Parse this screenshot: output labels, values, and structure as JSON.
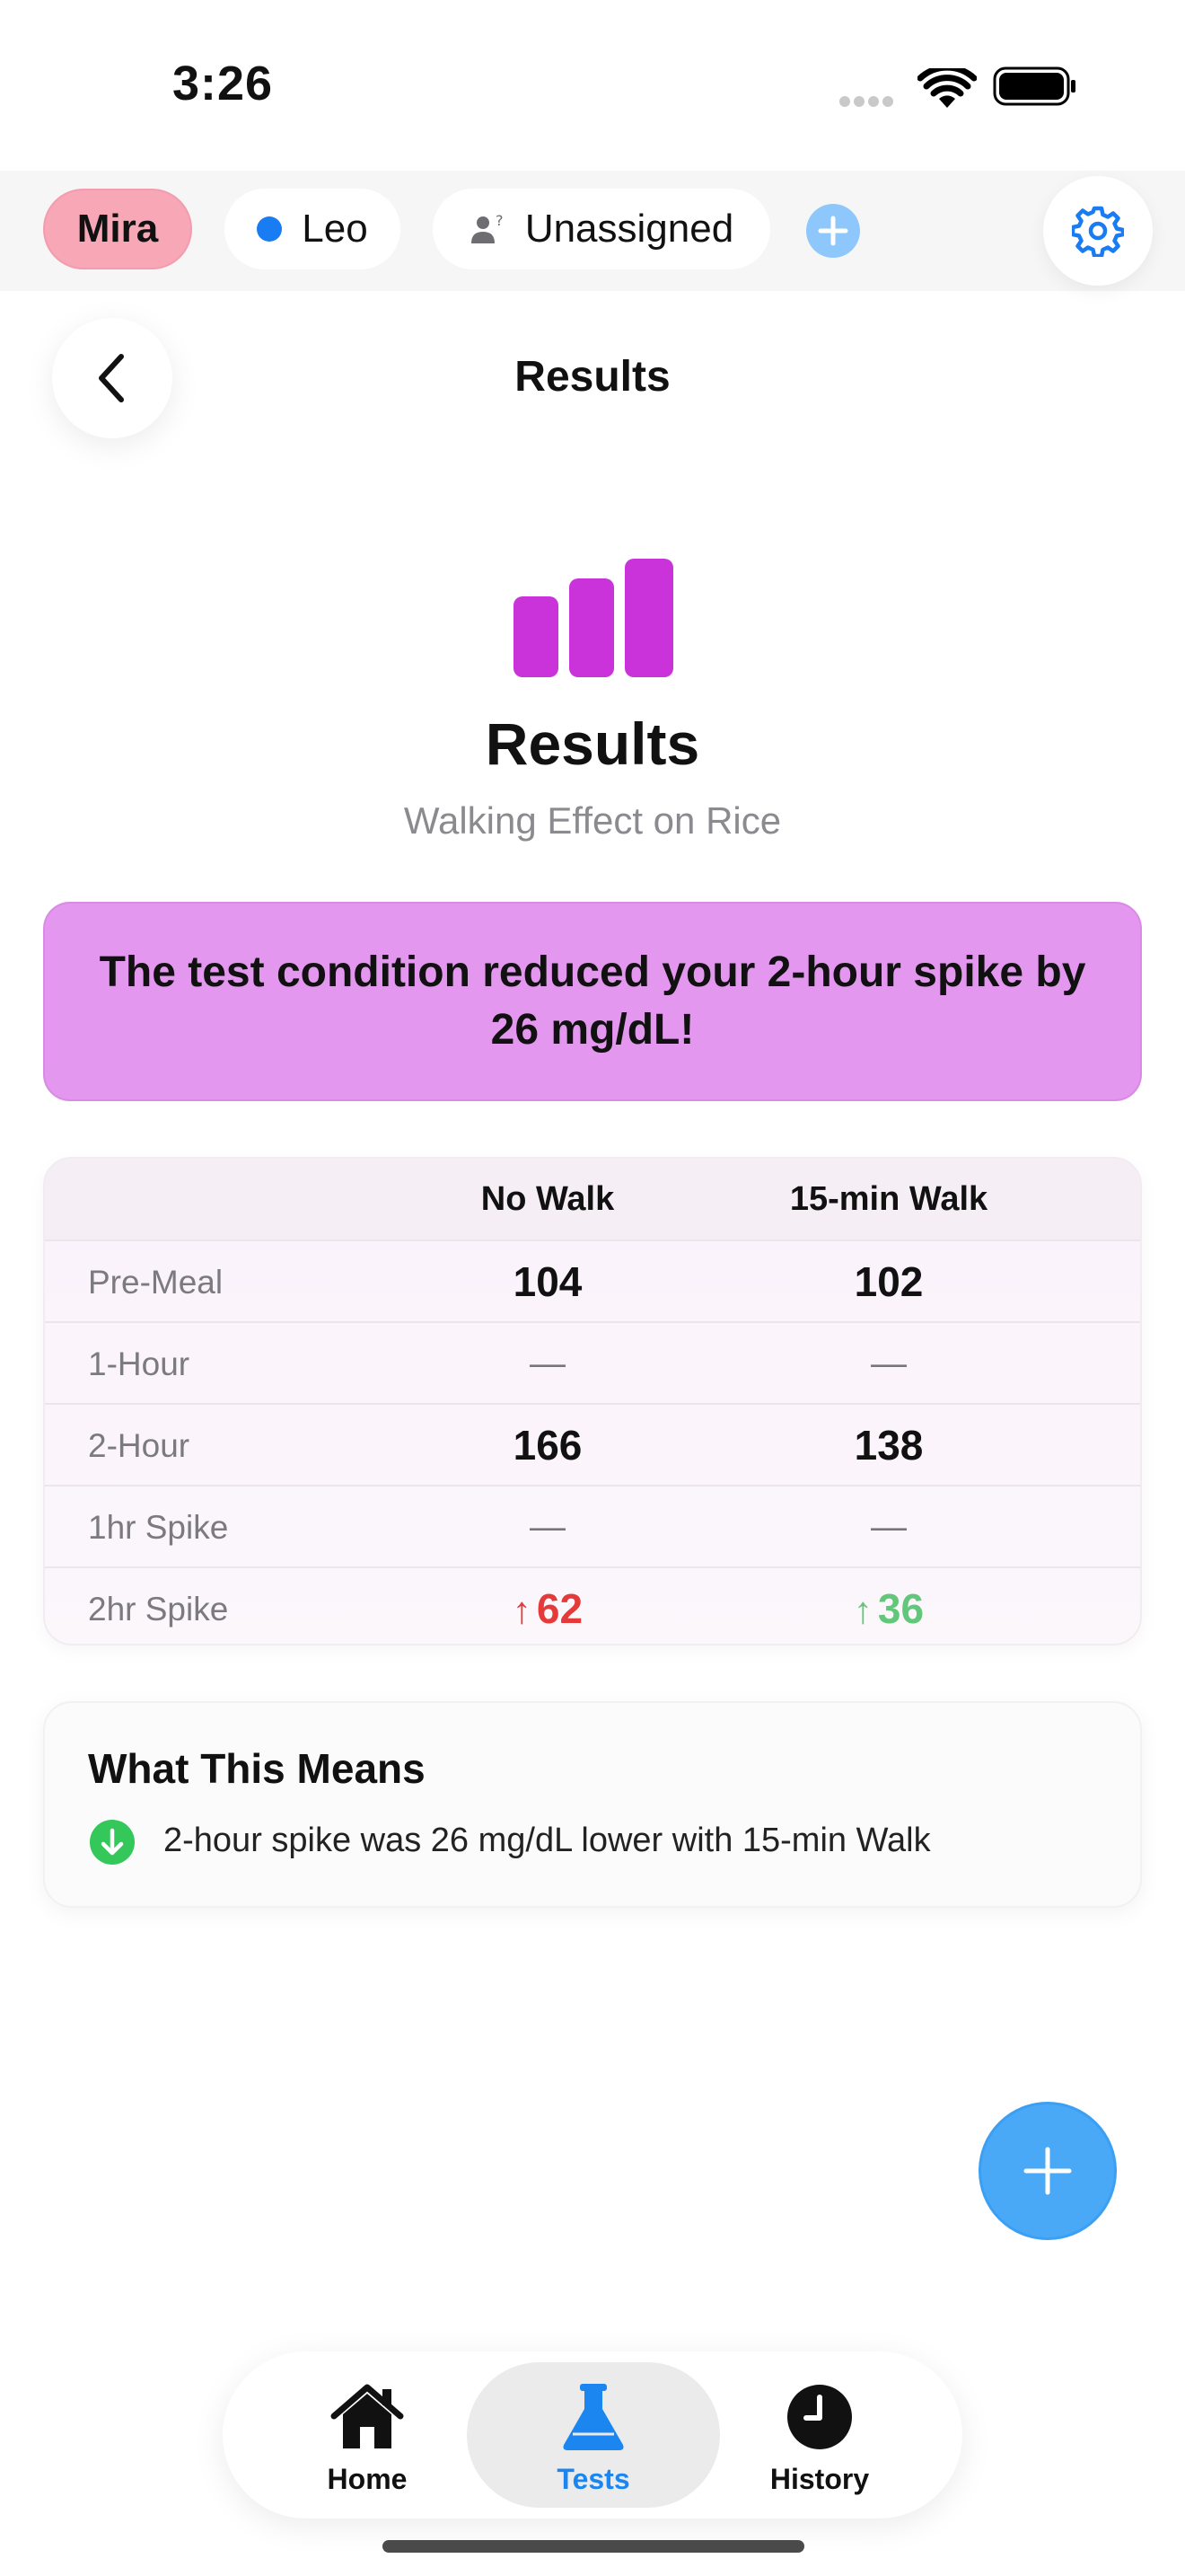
{
  "status_bar": {
    "time": "3:26"
  },
  "profiles": {
    "items": [
      {
        "label": "Mira",
        "selected": true,
        "color": "#f7a7b6"
      },
      {
        "label": "Leo",
        "selected": false,
        "dot_color": "#1a7cf2"
      },
      {
        "label": "Unassigned",
        "selected": false,
        "icon": "person-question-icon"
      }
    ],
    "add_icon": "plus-icon",
    "settings_icon": "gear-icon"
  },
  "nav": {
    "title": "Results",
    "back_icon": "chevron-left-icon"
  },
  "hero": {
    "icon": "bar-chart-icon",
    "icon_color": "#c933d9",
    "title": "Results",
    "subtitle": "Walking Effect on Rice"
  },
  "banner": {
    "text": "The test condition reduced your 2-hour spike by 26 mg/dL!",
    "color": "#e497ee"
  },
  "table": {
    "columns": [
      "",
      "No Walk",
      "15-min Walk"
    ],
    "rows": [
      {
        "label": "Pre-Meal",
        "a": "104",
        "b": "102"
      },
      {
        "label": "1-Hour",
        "a": "—",
        "b": "—"
      },
      {
        "label": "2-Hour",
        "a": "166",
        "b": "138"
      },
      {
        "label": "1hr Spike",
        "a": "—",
        "b": "—"
      },
      {
        "label": "2hr Spike",
        "a": "62",
        "b": "36",
        "a_arrow": "↑",
        "b_arrow": "↑",
        "a_color": "#e43a3a",
        "b_color": "#62c77a"
      }
    ]
  },
  "means": {
    "title": "What This Means",
    "icon": "arrow-down-circle-icon",
    "icon_color": "#34c759",
    "text": "2-hour spike was 26 mg/dL lower with 15-min Walk"
  },
  "fab": {
    "icon": "plus-icon",
    "color": "#4aa9f7"
  },
  "tabs": [
    {
      "label": "Home",
      "icon": "house-icon",
      "active": false
    },
    {
      "label": "Tests",
      "icon": "flask-icon",
      "active": true
    },
    {
      "label": "History",
      "icon": "clock-icon",
      "active": false
    }
  ]
}
